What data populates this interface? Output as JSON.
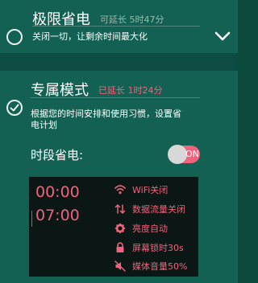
{
  "modes": [
    {
      "title": "极限省电",
      "extend_text": "可延长 5时47分",
      "description": "关闭一切，让剩余时间最大化",
      "selected": false
    },
    {
      "title": "专属模式",
      "extend_text": "已延长 1时24分",
      "description_line1": "根据您的时间安排和使用习惯，设置省",
      "description_line2": "电计划",
      "selected": true
    }
  ],
  "schedule": {
    "label": "时段省电:",
    "toggle_state": "ON",
    "start_time": "00:00",
    "end_time": "07:00",
    "features": [
      {
        "icon": "wifi-icon",
        "label": "WiFi关闭"
      },
      {
        "icon": "data-transfer-icon",
        "label": "数据流量关闭"
      },
      {
        "icon": "brightness-icon",
        "label": "亮度自动"
      },
      {
        "icon": "lock-icon",
        "label": "屏幕锁时30s"
      },
      {
        "icon": "mute-icon",
        "label": "媒体音量50%"
      }
    ]
  },
  "colors": {
    "background": "#0c4a3e",
    "card": "#136152",
    "accent": "#f0627d",
    "panel": "#0b1714"
  }
}
